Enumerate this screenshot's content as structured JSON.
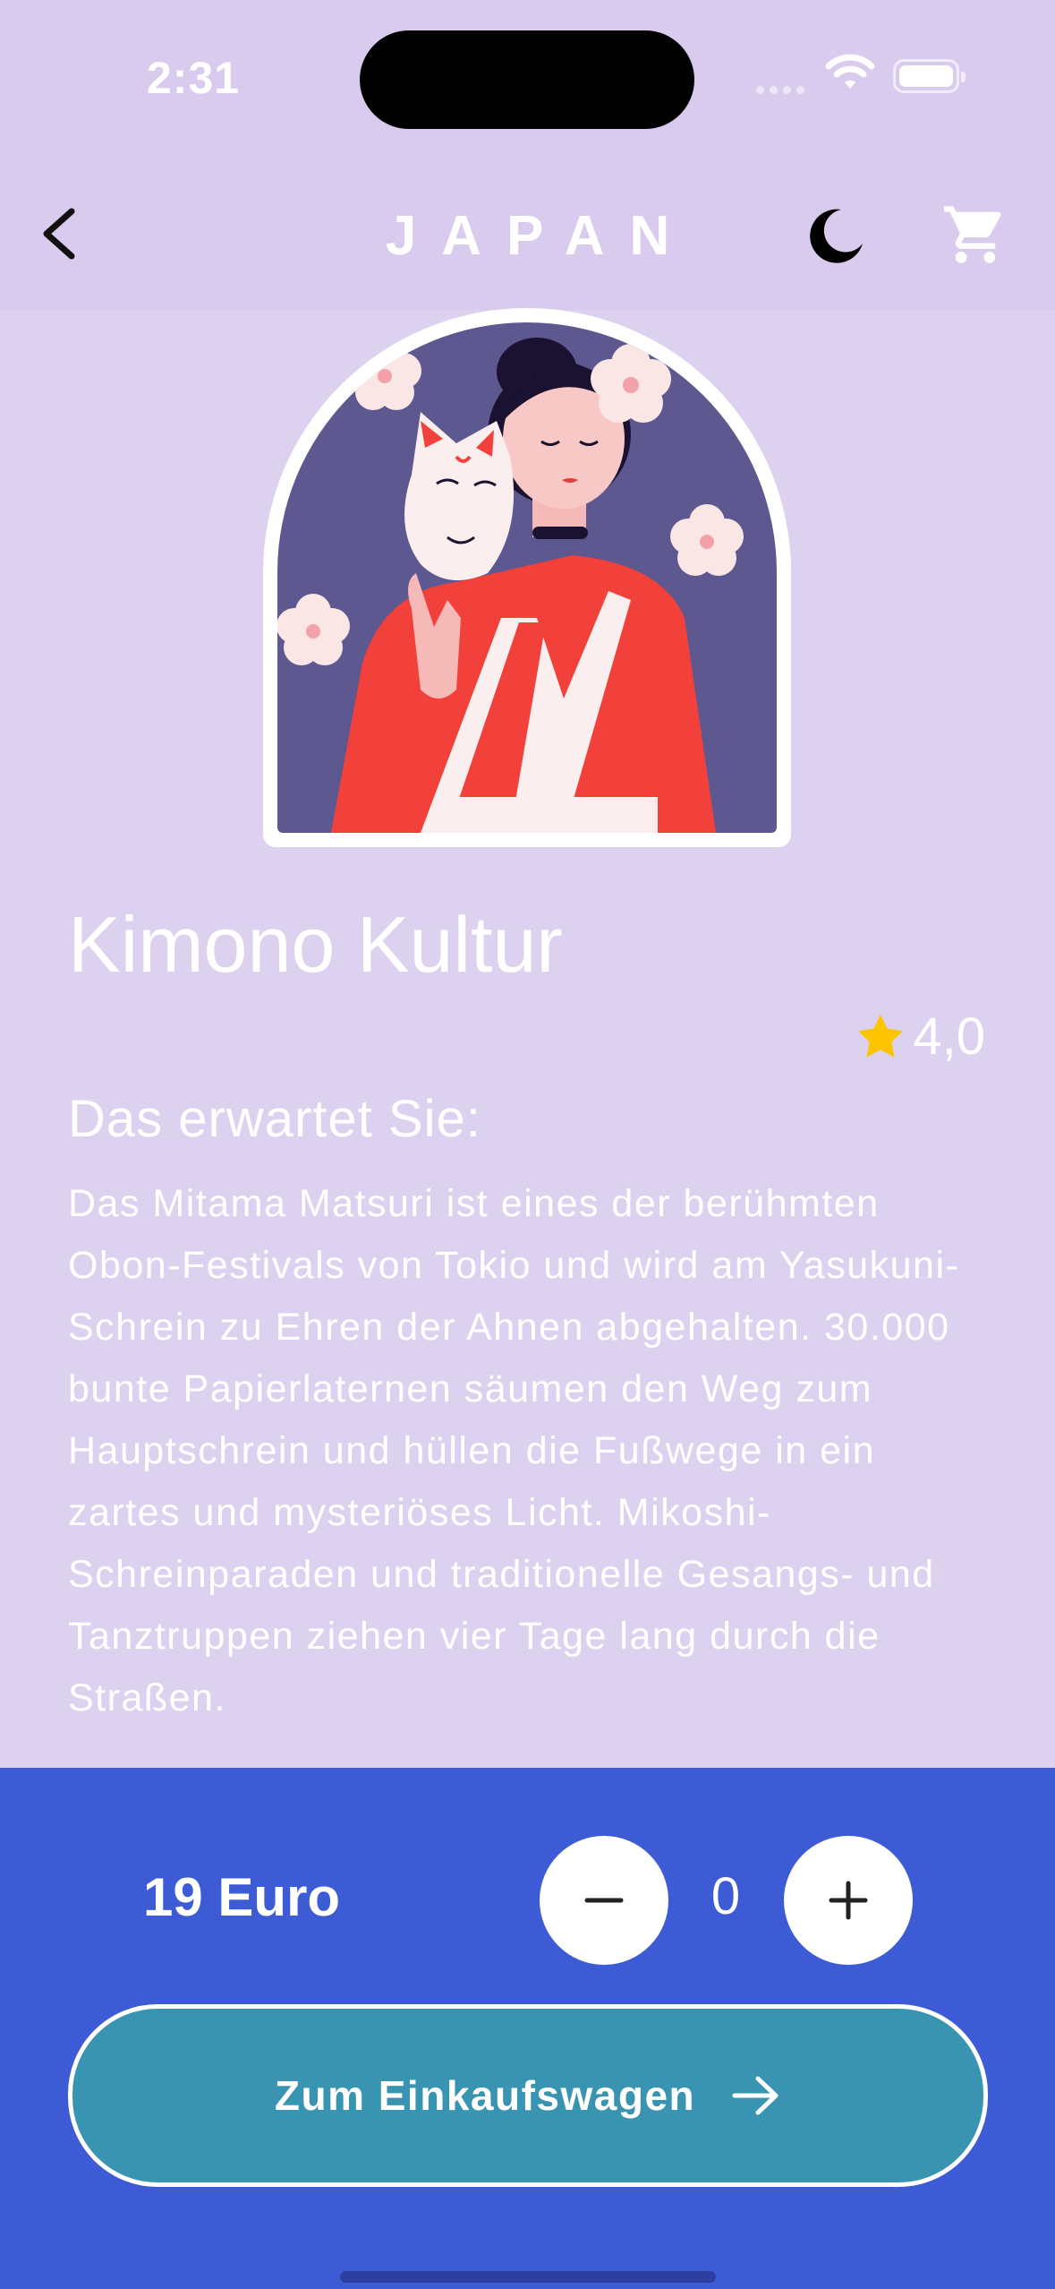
{
  "status_bar": {
    "time": "2:31"
  },
  "header": {
    "title": "JAPAN"
  },
  "product": {
    "title": "Kimono Kultur",
    "rating": "4,0",
    "section_heading": "Das erwartet Sie:",
    "description": "Das Mitama Matsuri ist eines der berühmten Obon-Festivals von Tokio und wird am Yasukuni-Schrein zu Ehren der Ahnen abgehalten. 30.000 bunte Papierlaternen säumen den Weg zum Hauptschrein und hüllen die Fußwege in ein zartes und mysteriöses Licht. Mikoshi-Schreinparaden und traditionelle Gesangs- und Tanztruppen ziehen vier Tage lang durch die Straßen."
  },
  "purchase": {
    "price": "19 Euro",
    "quantity": "0",
    "cta_label": "Zum Einkaufswagen"
  },
  "icons": [
    "back-icon",
    "moon-icon",
    "cart-icon",
    "star-icon",
    "minus-icon",
    "plus-icon",
    "arrow-right-icon"
  ],
  "colors": {
    "background": "#ddd1f0",
    "header": "#d9cbee",
    "bottom_panel": "#3e5bd6",
    "cta_button": "#3894b1",
    "star": "#ffc400",
    "illustration_bg": "#5e5891",
    "kimono": "#f2403a"
  }
}
